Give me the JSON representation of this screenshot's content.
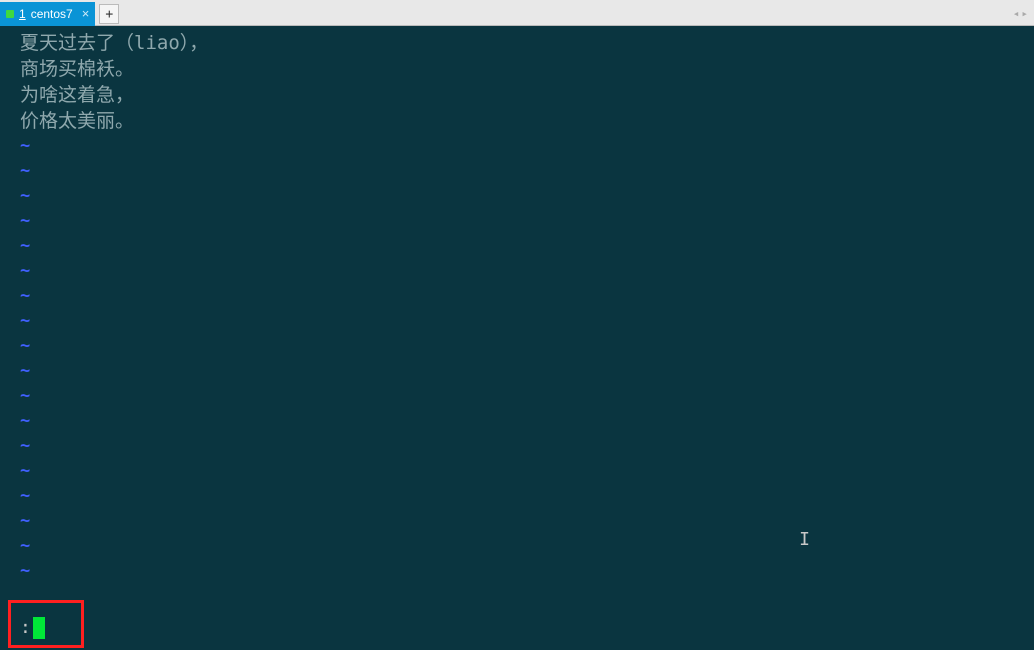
{
  "tabs": {
    "active": {
      "number": "1",
      "label": "centos7"
    }
  },
  "editor": {
    "lines": [
      "夏天过去了（liao），",
      "商场买棉袄。",
      "为啥这着急，",
      "价格太美丽。"
    ],
    "tilde": "~",
    "tilde_count": 18,
    "command_prefix": ":"
  },
  "nav": {
    "prev": "◂",
    "next": "▸"
  }
}
